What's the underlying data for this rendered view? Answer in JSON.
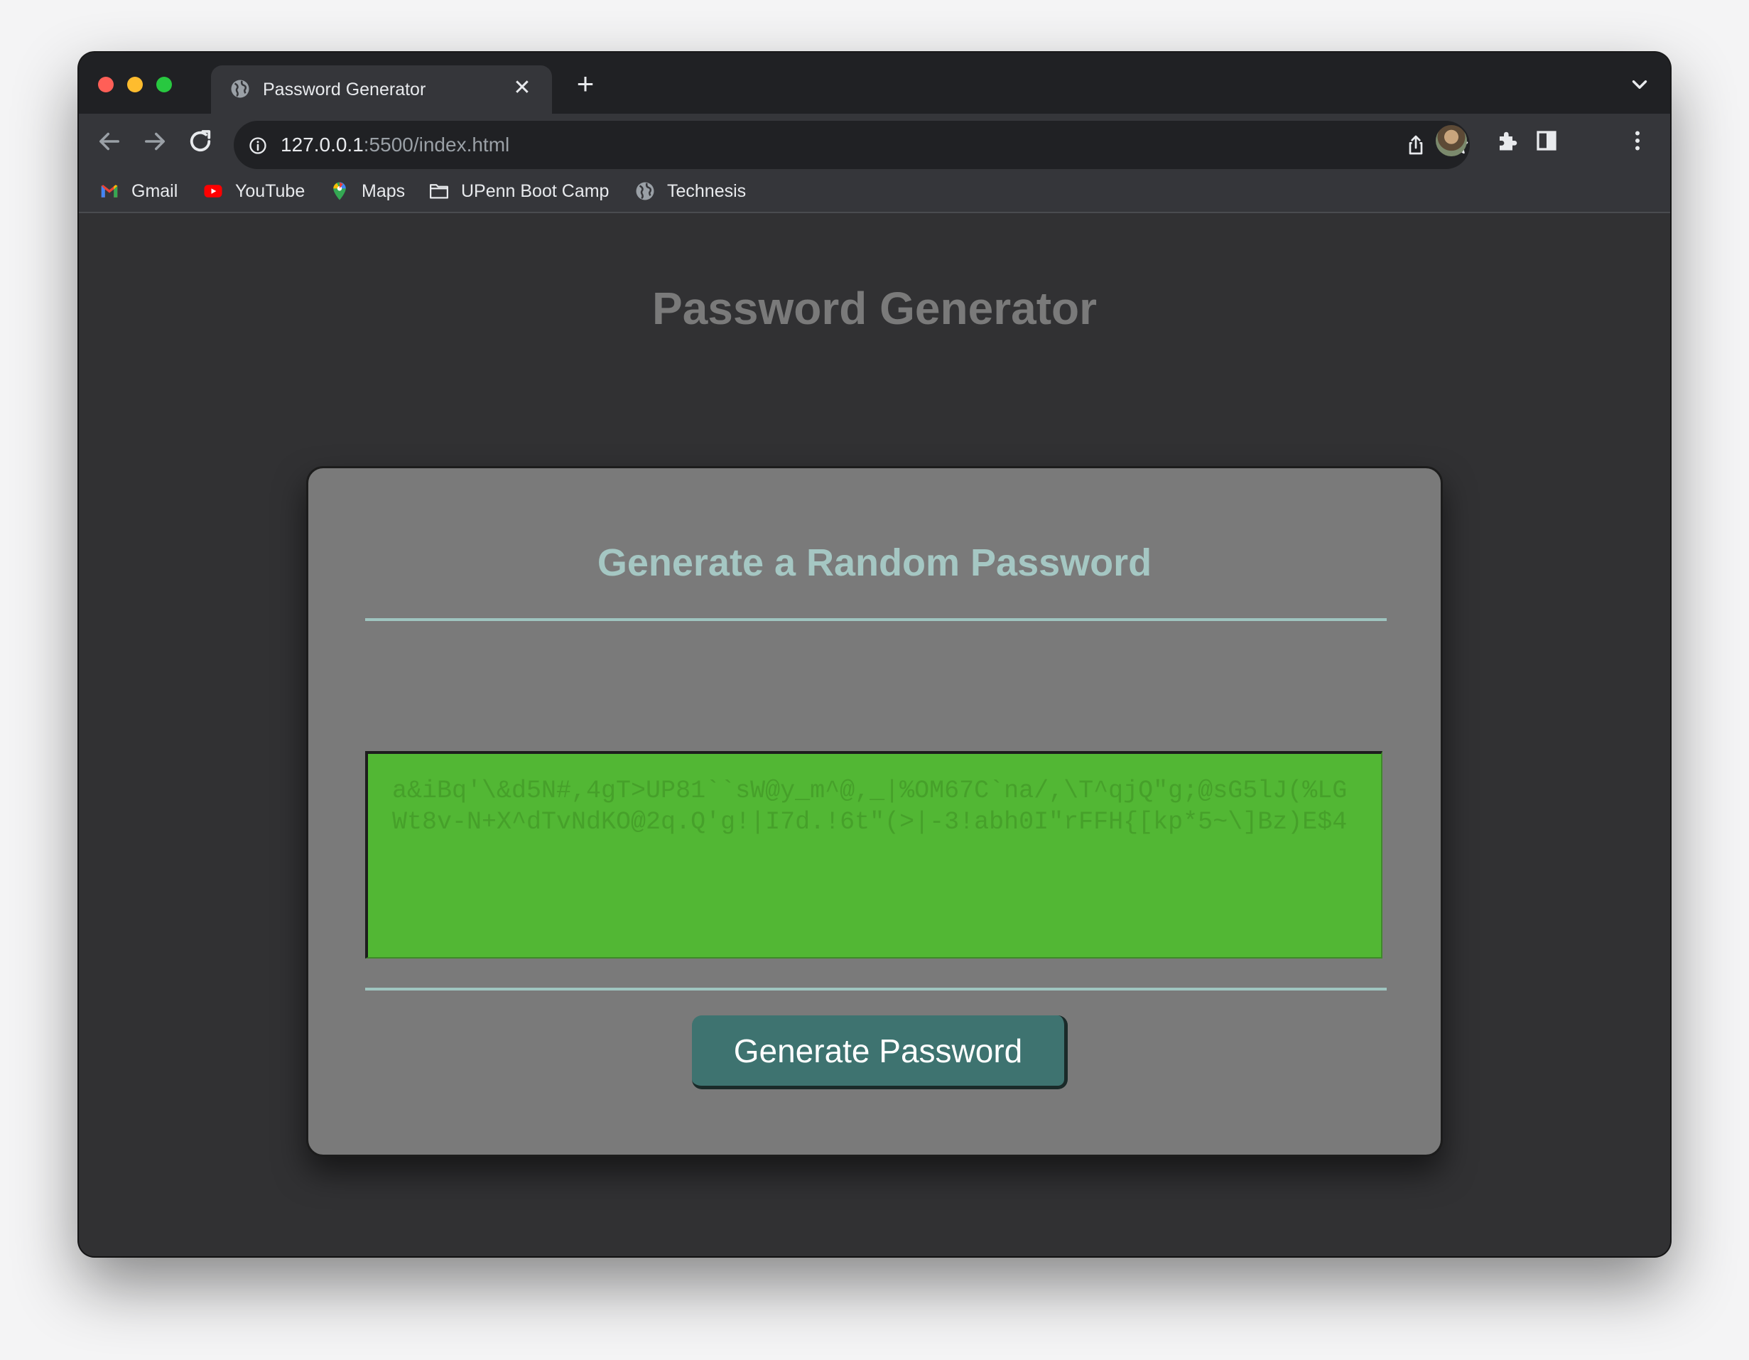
{
  "browser": {
    "tab": {
      "title": "Password Generator",
      "close_glyph": "✕",
      "icon": "globe-icon"
    },
    "new_tab_glyph": "+",
    "address": {
      "host": "127.0.0.1",
      "path": ":5500/index.html"
    },
    "bookmarks": [
      {
        "label": "Gmail",
        "icon": "gmail-icon"
      },
      {
        "label": "YouTube",
        "icon": "youtube-icon"
      },
      {
        "label": "Maps",
        "icon": "maps-icon"
      },
      {
        "label": "UPenn Boot Camp",
        "icon": "folder-icon"
      },
      {
        "label": "Technesis",
        "icon": "globe-icon"
      }
    ]
  },
  "page": {
    "title": "Password Generator",
    "card": {
      "title": "Generate a Random Password",
      "password": "a&iBq'\\&d5N#,4gT>UP81``sW@y_m^@,_|%OM67C`na/,\\T^qjQ\"g;@sG5lJ(%LGWt8v-N+X^dTvNdKO@2q.Q'g!|I7d.!6t\"(>|-3!abh0I\"rFFH{[kp*5~\\]Bz)E$4",
      "button_label": "Generate Password"
    }
  },
  "colors": {
    "page_bg": "#313133",
    "card_bg": "#7a7a7a",
    "card_title": "#a5c7c3",
    "password_bg": "#52b734",
    "button_bg": "#3e7370"
  }
}
